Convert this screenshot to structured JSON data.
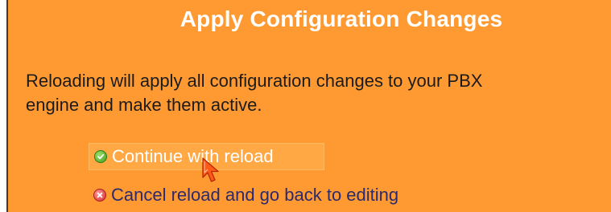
{
  "dialog": {
    "title": "Apply Configuration Changes",
    "message_line1": "Reloading will apply all configuration changes to your PBX",
    "message_line2": "engine and make them active."
  },
  "actions": {
    "continue_label": "Continue with reload",
    "cancel_label": "Cancel reload and go back to editing"
  },
  "icons": {
    "continue": "check-circle-icon",
    "cancel": "x-circle-icon",
    "cursor": "mouse-pointer-icon"
  },
  "colors": {
    "panel_background": "#ff9a33",
    "title_text": "#ffffff",
    "continue_highlight": "#ffa844",
    "link_text": "#2a2a6e"
  }
}
